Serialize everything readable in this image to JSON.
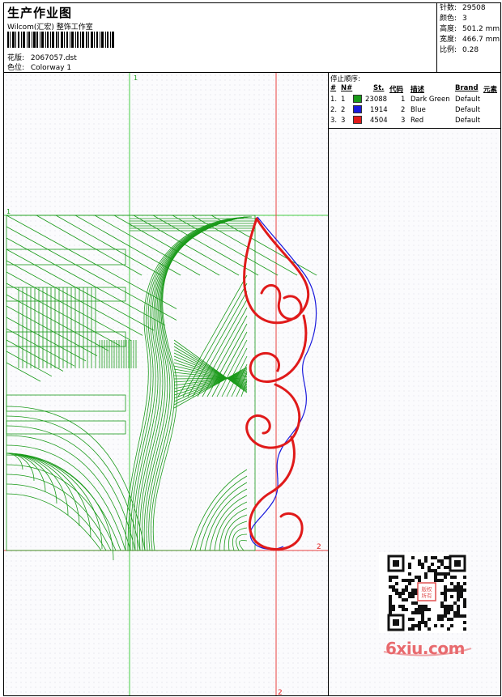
{
  "header": {
    "title": "生产作业图",
    "subtitle": "Wilcom(汇宏) 整饰工作室",
    "design_label": "花版:",
    "design_value": "2067057.dst",
    "colorway_label": "色位:",
    "colorway_value": "Colorway 1"
  },
  "stats": [
    {
      "label": "针数:",
      "value": "29508"
    },
    {
      "label": "颜色:",
      "value": "3"
    },
    {
      "label": "高度:",
      "value": "501.2 mm"
    },
    {
      "label": "宽度:",
      "value": "466.7 mm"
    },
    {
      "label": "比例:",
      "value": "0.28"
    }
  ],
  "stop_sequence": {
    "title": "停止顺序:",
    "columns": [
      "#",
      "N#",
      "St.",
      "代码",
      "描述",
      "Brand",
      "元素"
    ],
    "rows": [
      {
        "num": "1.",
        "n": "1",
        "color": "#1a9a1a",
        "stitches": "23088",
        "code": "1",
        "desc": "Dark Green",
        "brand": "Default"
      },
      {
        "num": "2.",
        "n": "2",
        "color": "#1a1adc",
        "stitches": "1914",
        "code": "2",
        "desc": "Blue",
        "brand": "Default"
      },
      {
        "num": "3.",
        "n": "3",
        "color": "#e01a1a",
        "stitches": "4504",
        "code": "3",
        "desc": "Red",
        "brand": "Default"
      }
    ]
  },
  "guides": {
    "top_label": "1",
    "left_label": "1",
    "right_label": "2",
    "bottom_label": "2"
  },
  "watermark": {
    "text": "6xiu.com",
    "stamp": "版权所有"
  },
  "colors": {
    "green": "#1a9a1a",
    "blue": "#1a1adc",
    "red": "#e01a1a"
  }
}
